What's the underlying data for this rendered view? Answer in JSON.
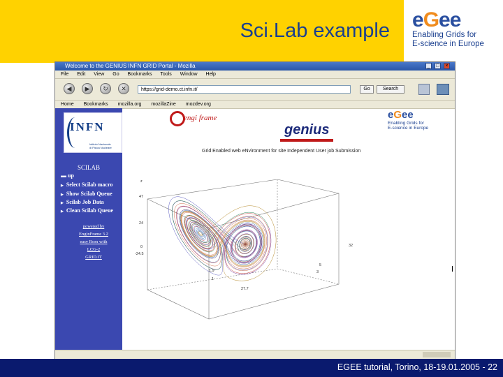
{
  "slide": {
    "title": "Sci.Lab example",
    "footer": "EGEE tutorial, Torino, 18-19.01.2005 - 22"
  },
  "logo": {
    "wordmark_left": "e",
    "wordmark_mid": "G",
    "wordmark_right": "ee",
    "tagline_1": "Enabling Grids for",
    "tagline_2": "E-science in Europe"
  },
  "browser": {
    "window_title": "Welcome to the GENIUS INFN GRID Portal - Mozilla",
    "menu": [
      "File",
      "Edit",
      "View",
      "Go",
      "Bookmarks",
      "Tools",
      "Window",
      "Help"
    ],
    "url": "https://grid-demo.ct.infn.it/",
    "go_label": "Go",
    "search_label": "Search",
    "bookmarks": [
      "Home",
      "Bookmarks",
      "mozilla.org",
      "mozillaZine",
      "mozdev.org"
    ]
  },
  "page": {
    "sidebar": {
      "institute": "INFN",
      "institute_sub_1": "Istituto Nazionale",
      "institute_sub_2": "di Fisica Nucleare",
      "heading": "SCILAB",
      "up_label": "up",
      "items": [
        "Select Scilab macro",
        "Show Scilab Queue",
        "Scilab Job Data",
        "Clean Scilab Queue"
      ],
      "links": [
        "powered by",
        "EnginFrame 3.2",
        "easy Rom with",
        "LCG-2",
        "GRID.IT"
      ]
    },
    "enginframe_label": "engi frame",
    "genius_label": "genius",
    "egee_small_1": "Enabling Grids for",
    "egee_small_2": "E-science in Europe",
    "subtitle": "Grid Enabled web eNvironment for site Independent User job Submission"
  },
  "chart_data": {
    "type": "line",
    "title": "",
    "description_ticks": [
      "z",
      "47",
      "24",
      "0",
      "-24.5",
      "1.9",
      "1",
      "27.7",
      "3",
      "5",
      "32"
    ],
    "series": []
  },
  "colors": {
    "title_band": "#ffd200",
    "footer_band": "#0a1a6e",
    "sidebar": "#3b48b0",
    "title_text": "#1a3f8f"
  },
  "icons": {
    "back": "back-arrow-icon",
    "forward": "forward-arrow-icon",
    "reload": "reload-icon",
    "stop": "stop-icon"
  }
}
